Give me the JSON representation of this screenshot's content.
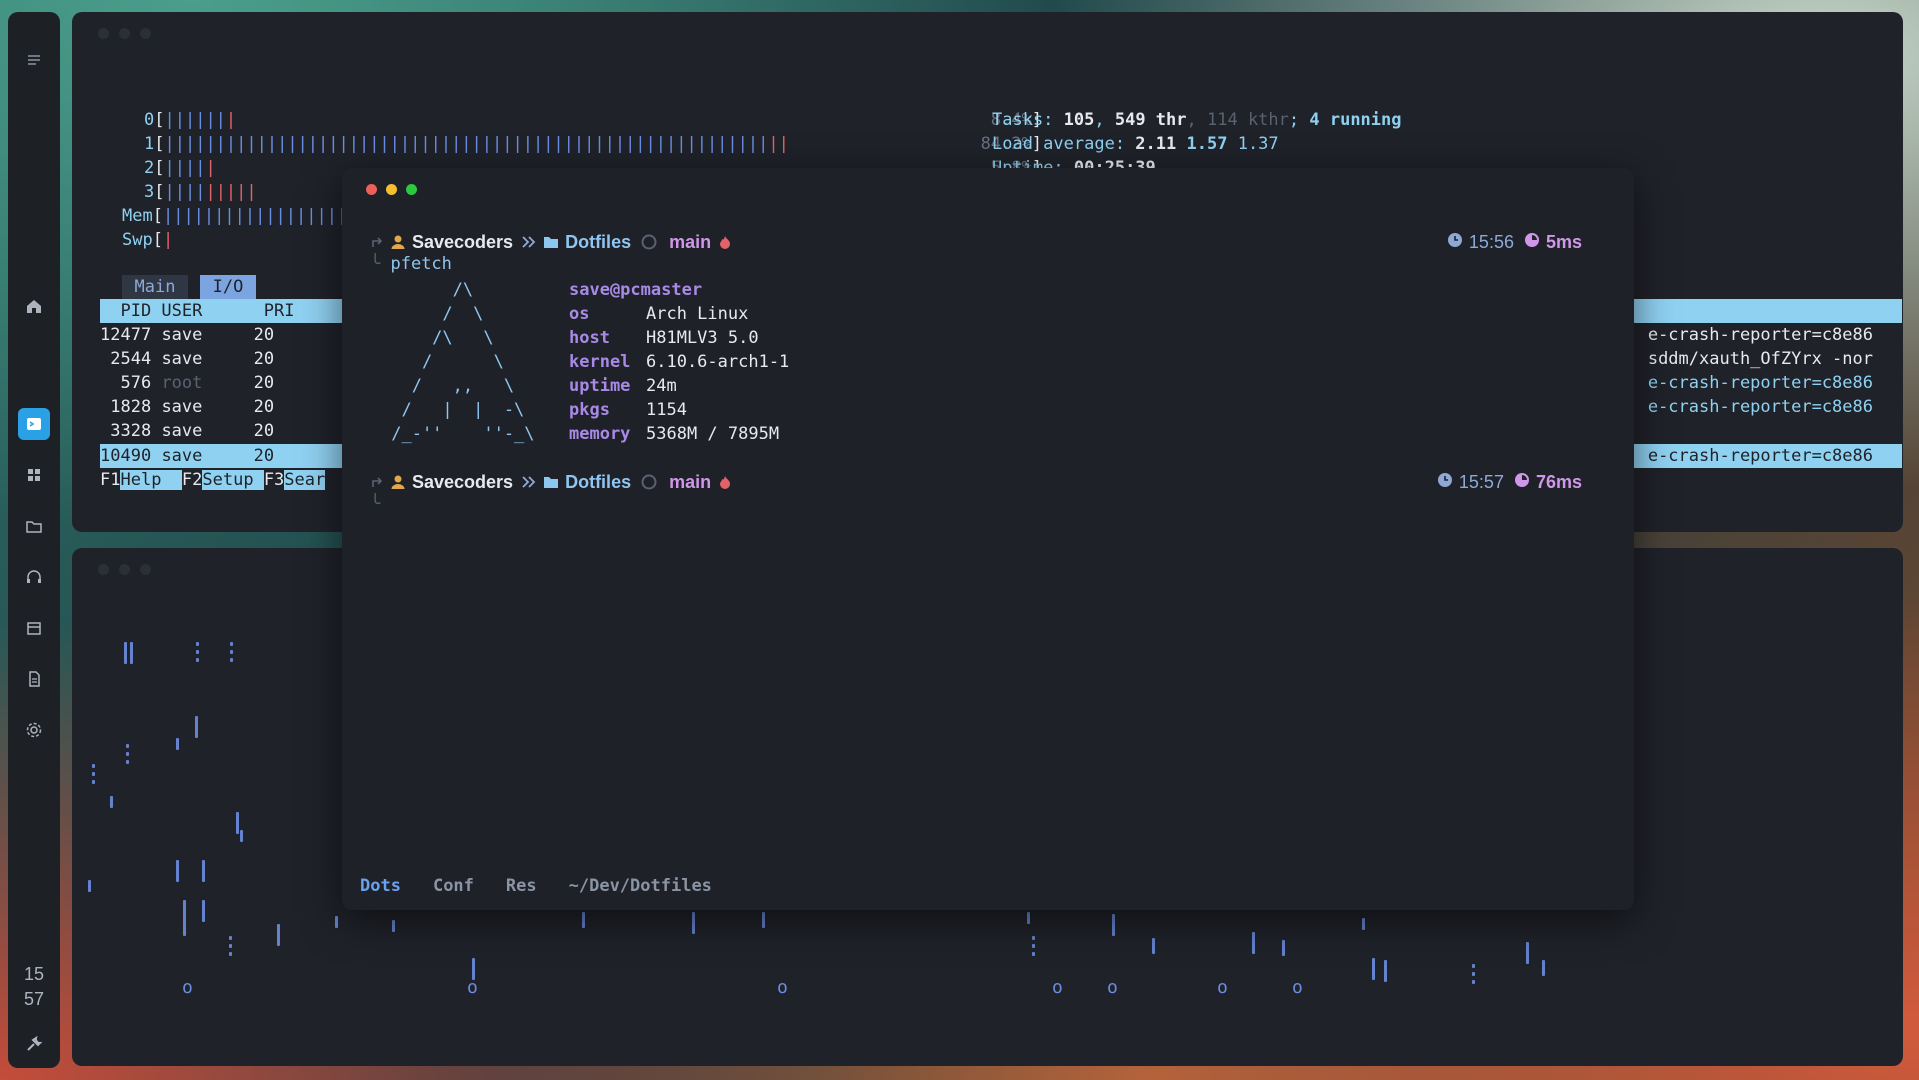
{
  "dock": {
    "items": [
      {
        "name": "menu-icon"
      },
      {
        "name": "home-icon"
      },
      {
        "name": "terminal-icon",
        "active": true
      },
      {
        "name": "apps-icon"
      },
      {
        "name": "folder-icon"
      },
      {
        "name": "headphones-icon"
      },
      {
        "name": "calendar-icon"
      },
      {
        "name": "document-icon"
      },
      {
        "name": "settings-icon"
      },
      {
        "name": "wrench-icon"
      }
    ],
    "clock_hour": "15",
    "clock_min": "57"
  },
  "htop": {
    "cpu": [
      {
        "label": "0",
        "bars_blue": "||||||",
        "bars_red": "|",
        "pct": "8.4%"
      },
      {
        "label": "1",
        "bars_blue": "|||||||||||||||||||||||||||||||||||||||||||||||||||||||||||",
        "bars_red": "||",
        "pct": "84.2%"
      },
      {
        "label": "2",
        "bars_blue": "||||",
        "bars_red": "|",
        "pct": "5.8%"
      },
      {
        "label": "3",
        "bars_blue": "||||",
        "bars_red": "|||||",
        "pct": ""
      }
    ],
    "mem": {
      "label": "Mem",
      "bars": "||||||||||||||||||"
    },
    "swp": {
      "label": "Swp",
      "bars": "|"
    },
    "tasks": {
      "label": "Tasks: ",
      "count": "105",
      "sep1": ", ",
      "thr": "549 thr",
      "sep2": ", ",
      "kthr": "114 kthr",
      "sep3": "; ",
      "running": "4 running"
    },
    "load": {
      "label": "Load average: ",
      "v1": "2.11",
      "v2": "1.57",
      "v3": "1.37"
    },
    "uptime": {
      "label": "Uptime: ",
      "value": "00:25:39"
    },
    "tabs": {
      "main": "Main",
      "io": "I/O"
    },
    "header": "  PID USER      PRI",
    "processes": [
      {
        "pid": "12477",
        "user": "save",
        "pri": "20",
        "cmd": "e-crash-reporter=c8e86",
        "hl": false
      },
      {
        "pid": " 2544",
        "user": "save",
        "pri": "20",
        "cmd": "sddm/xauth_OfZYrx -nor",
        "hl": false
      },
      {
        "pid": "  576",
        "user": "root",
        "pri": "20",
        "cmd": "e-crash-reporter=c8e86",
        "hl": true
      },
      {
        "pid": " 1828",
        "user": "save",
        "pri": "20",
        "cmd": "e-crash-reporter=c8e86",
        "hl": true
      },
      {
        "pid": " 3328",
        "user": "save",
        "pri": "20",
        "cmd": "e-crash-reporter=c8e86",
        "hl": true
      }
    ],
    "selected": {
      "pid": "10490",
      "user": "save",
      "pri": "20"
    },
    "fkeys": [
      {
        "key": "F1",
        "label": "Help  "
      },
      {
        "key": "F2",
        "label": "Setup "
      },
      {
        "key": "F3",
        "label": "Sear"
      }
    ]
  },
  "terminal": {
    "prompt1": {
      "user": "Savecoders",
      "dir": "Dotfiles",
      "branch": "main",
      "time": "15:56",
      "ms": "5ms"
    },
    "command": "pfetch",
    "pfetch": {
      "title": "save@pcmaster",
      "rows": [
        {
          "k": "os",
          "v": "Arch Linux"
        },
        {
          "k": "host",
          "v": "H81MLV3 5.0"
        },
        {
          "k": "kernel",
          "v": "6.10.6-arch1-1"
        },
        {
          "k": "uptime",
          "v": "24m"
        },
        {
          "k": "pkgs",
          "v": "1154"
        },
        {
          "k": "memory",
          "v": "5368M / 7895M"
        }
      ],
      "art": "       /\\\n      /  \\\n     /\\   \\\n    /      \\\n   /   ,,   \\\n  /   |  |  -\\\n /_-''    ''-_\\"
    },
    "prompt2": {
      "user": "Savecoders",
      "dir": "Dotfiles",
      "branch": "main",
      "time": "15:57",
      "ms": "76ms"
    },
    "tabs": [
      "Dots",
      "Conf",
      "Res",
      "~/Dev/Dotfiles"
    ],
    "active_tab": "Dots"
  },
  "colors": {
    "accent": "#8fd1f1",
    "blue": "#6b8de0",
    "red": "#e0626a",
    "purple": "#a88ae6"
  }
}
